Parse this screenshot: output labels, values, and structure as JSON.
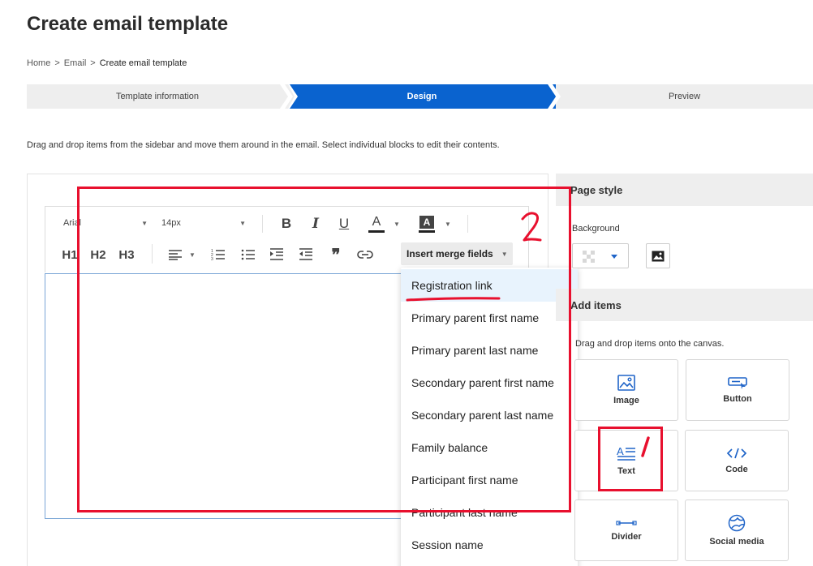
{
  "page": {
    "title": "Create email template",
    "instructions": "Drag and drop items from the sidebar and move them around in the email. Select individual blocks to edit their contents."
  },
  "breadcrumb": {
    "items": [
      "Home",
      "Email",
      "Create email template"
    ],
    "separator": ">"
  },
  "stepper": {
    "steps": [
      {
        "label": "Template information",
        "state": "complete"
      },
      {
        "label": "Design",
        "state": "active"
      },
      {
        "label": "Preview",
        "state": "upcoming"
      }
    ],
    "active_color": "#0a63cf"
  },
  "toolbar": {
    "font_family": "Arial",
    "font_size": "14px",
    "headings": [
      "H1",
      "H2",
      "H3"
    ],
    "merge_fields_label": "Insert merge fields"
  },
  "merge_menu": {
    "items": [
      "Registration link",
      "Primary parent first name",
      "Primary parent last name",
      "Secondary parent first name",
      "Secondary parent last name",
      "Family balance",
      "Participant first name",
      "Participant last name",
      "Session name"
    ],
    "selected_index": 0
  },
  "sidebar": {
    "page_style_title": "Page style",
    "background_label": "Background",
    "add_items_title": "Add items",
    "add_items_hint": "Drag and drop items onto the canvas.",
    "tiles": [
      {
        "label": "Image",
        "icon": "image-icon"
      },
      {
        "label": "Button",
        "icon": "button-icon"
      },
      {
        "label": "Text",
        "icon": "text-icon"
      },
      {
        "label": "Code",
        "icon": "code-icon"
      },
      {
        "label": "Divider",
        "icon": "divider-icon"
      },
      {
        "label": "Social media",
        "icon": "globe-icon"
      }
    ]
  },
  "annotations": {
    "step_one": "1",
    "step_two": "2",
    "color": "#e8102e"
  },
  "colors": {
    "accent": "#0a63cf",
    "icon_blue": "#1f64c8",
    "annotation_red": "#e8102e"
  }
}
